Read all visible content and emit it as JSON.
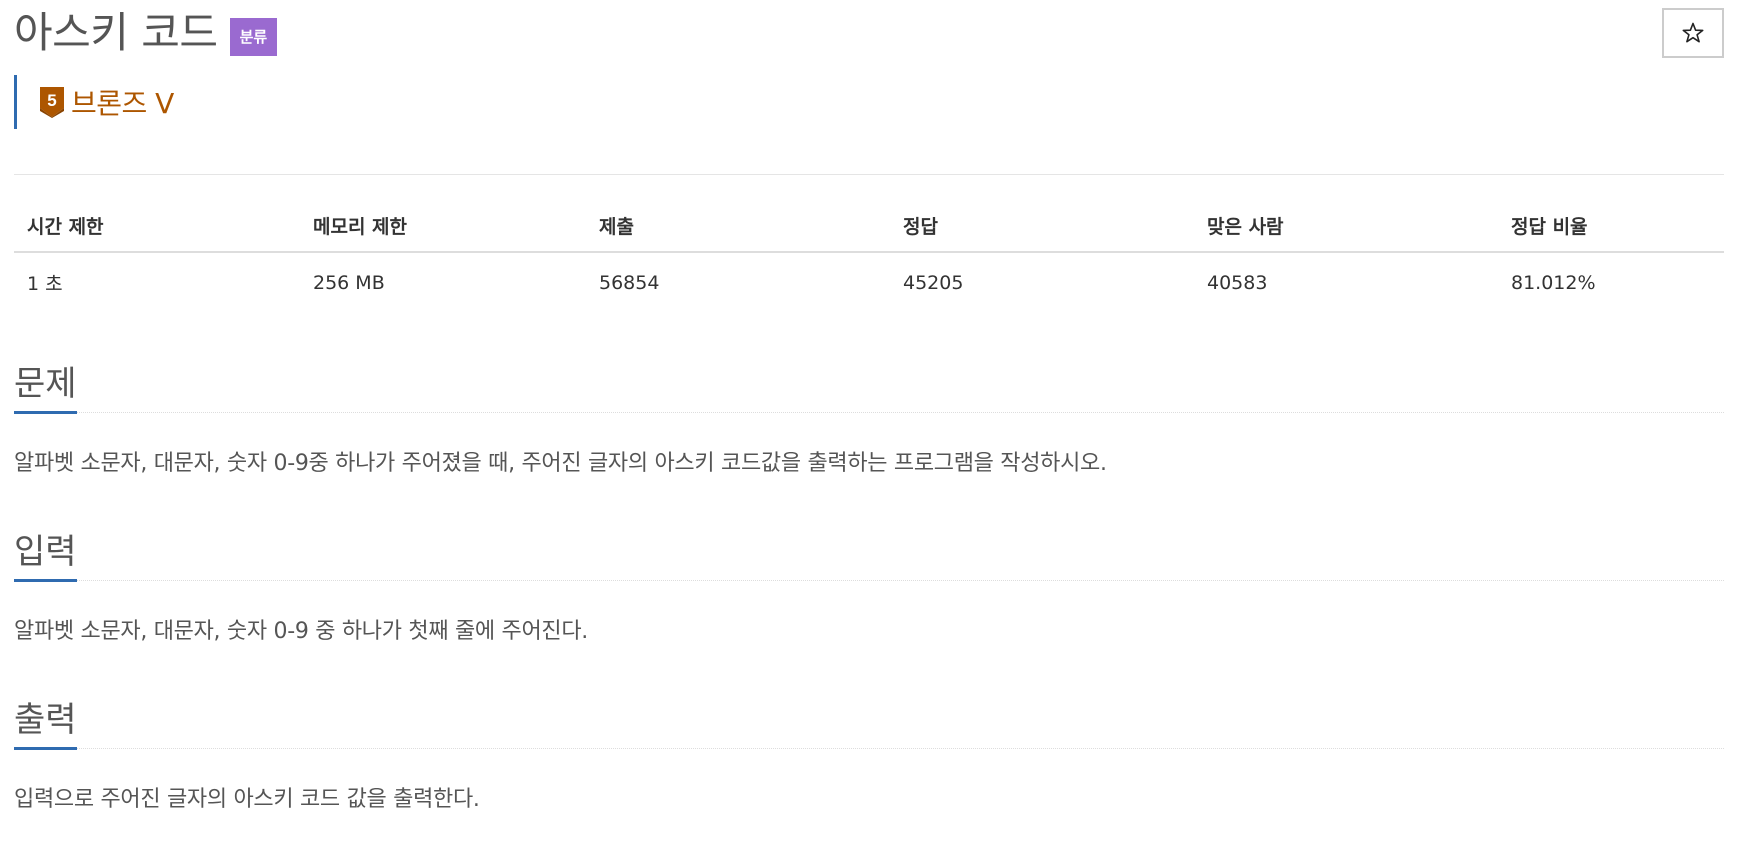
{
  "problem": {
    "title": "아스키 코드",
    "category_badge": "분류",
    "tier": {
      "number": "5",
      "label": "브론즈 V",
      "color": "#ad5600"
    },
    "star_icon": "star-outline-icon"
  },
  "info_table": {
    "headers": [
      "시간 제한",
      "메모리 제한",
      "제출",
      "정답",
      "맞은 사람",
      "정답 비율"
    ],
    "values": [
      "1 초",
      "256 MB",
      "56854",
      "45205",
      "40583",
      "81.012%"
    ]
  },
  "sections": {
    "problem": {
      "title": "문제",
      "body": "알파벳 소문자, 대문자, 숫자 0-9중 하나가 주어졌을 때, 주어진 글자의 아스키 코드값을 출력하는 프로그램을 작성하시오."
    },
    "input": {
      "title": "입력",
      "body": "알파벳 소문자, 대문자, 숫자 0-9 중 하나가 첫째 줄에 주어진다."
    },
    "output": {
      "title": "출력",
      "body": "입력으로 주어진 글자의 아스키 코드 값을 출력한다."
    }
  },
  "colors": {
    "accent_blue": "#2f6bb0",
    "badge_purple": "#9a6ad0",
    "bronze": "#ad5600"
  }
}
